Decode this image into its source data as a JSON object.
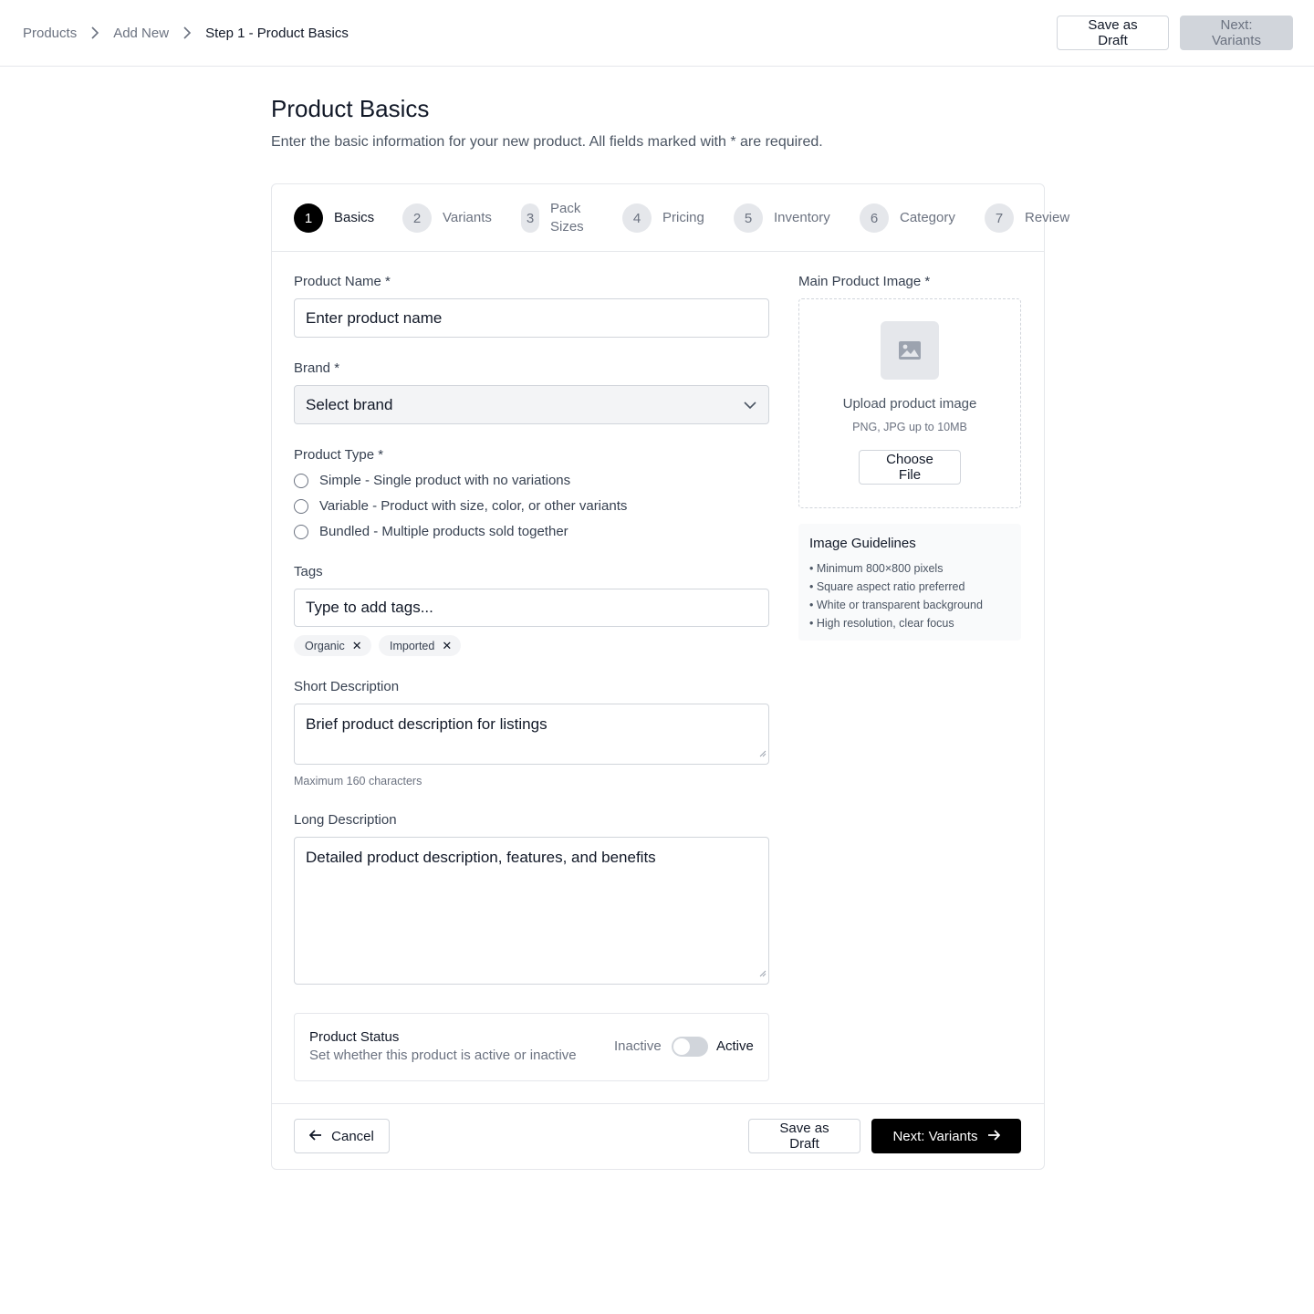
{
  "breadcrumb": {
    "items": [
      {
        "label": "Products"
      },
      {
        "label": "Add New"
      },
      {
        "label": "Step 1 - Product Basics"
      }
    ]
  },
  "header": {
    "save_draft_label": "Save as Draft",
    "next_label": "Next: Variants",
    "next_disabled": true
  },
  "page": {
    "title": "Product Basics",
    "subtitle": "Enter the basic information for your new product. All fields marked with * are required."
  },
  "stepper": {
    "active_step": 1,
    "steps": [
      {
        "num": "1",
        "label": "Basics"
      },
      {
        "num": "2",
        "label": "Variants"
      },
      {
        "num": "3",
        "label": "Pack Sizes"
      },
      {
        "num": "4",
        "label": "Pricing"
      },
      {
        "num": "5",
        "label": "Inventory"
      },
      {
        "num": "6",
        "label": "Category"
      },
      {
        "num": "7",
        "label": "Review"
      }
    ]
  },
  "form": {
    "product_name": {
      "label": "Product Name *",
      "placeholder": "Enter product name",
      "value": ""
    },
    "brand": {
      "label": "Brand *",
      "selected": "Select brand"
    },
    "product_type": {
      "label": "Product Type *",
      "options": [
        "Simple - Single product with no variations",
        "Variable - Product with size, color, or other variants",
        "Bundled - Multiple products sold together"
      ],
      "selected": null
    },
    "tags": {
      "label": "Tags",
      "placeholder": "Type to add tags...",
      "items": [
        "Organic",
        "Imported"
      ],
      "remove_glyph": "✕"
    },
    "short_description": {
      "label": "Short Description",
      "placeholder": "Brief product description for listings",
      "hint": "Maximum 160 characters"
    },
    "long_description": {
      "label": "Long Description",
      "placeholder": "Detailed product description, features, and benefits"
    },
    "status": {
      "title": "Product Status",
      "subtitle": "Set whether this product is active or inactive",
      "off_label": "Inactive",
      "on_label": "Active",
      "active": false
    }
  },
  "image_upload": {
    "label": "Main Product Image *",
    "icon": "image-icon",
    "title": "Upload product image",
    "hint": "PNG, JPG up to 10MB",
    "button": "Choose File"
  },
  "guidelines": {
    "title": "Image Guidelines",
    "items": [
      "• Minimum 800×800 pixels",
      "• Square aspect ratio preferred",
      "• White or transparent background",
      "• High resolution, clear focus"
    ]
  },
  "footer": {
    "cancel_label": "Cancel",
    "save_draft_label": "Save as Draft",
    "next_label": "Next: Variants"
  },
  "colors": {
    "primary": "#000000",
    "border": "#e5e7eb",
    "muted_text": "#6b7280",
    "disabled_button": "#d1d5db"
  }
}
